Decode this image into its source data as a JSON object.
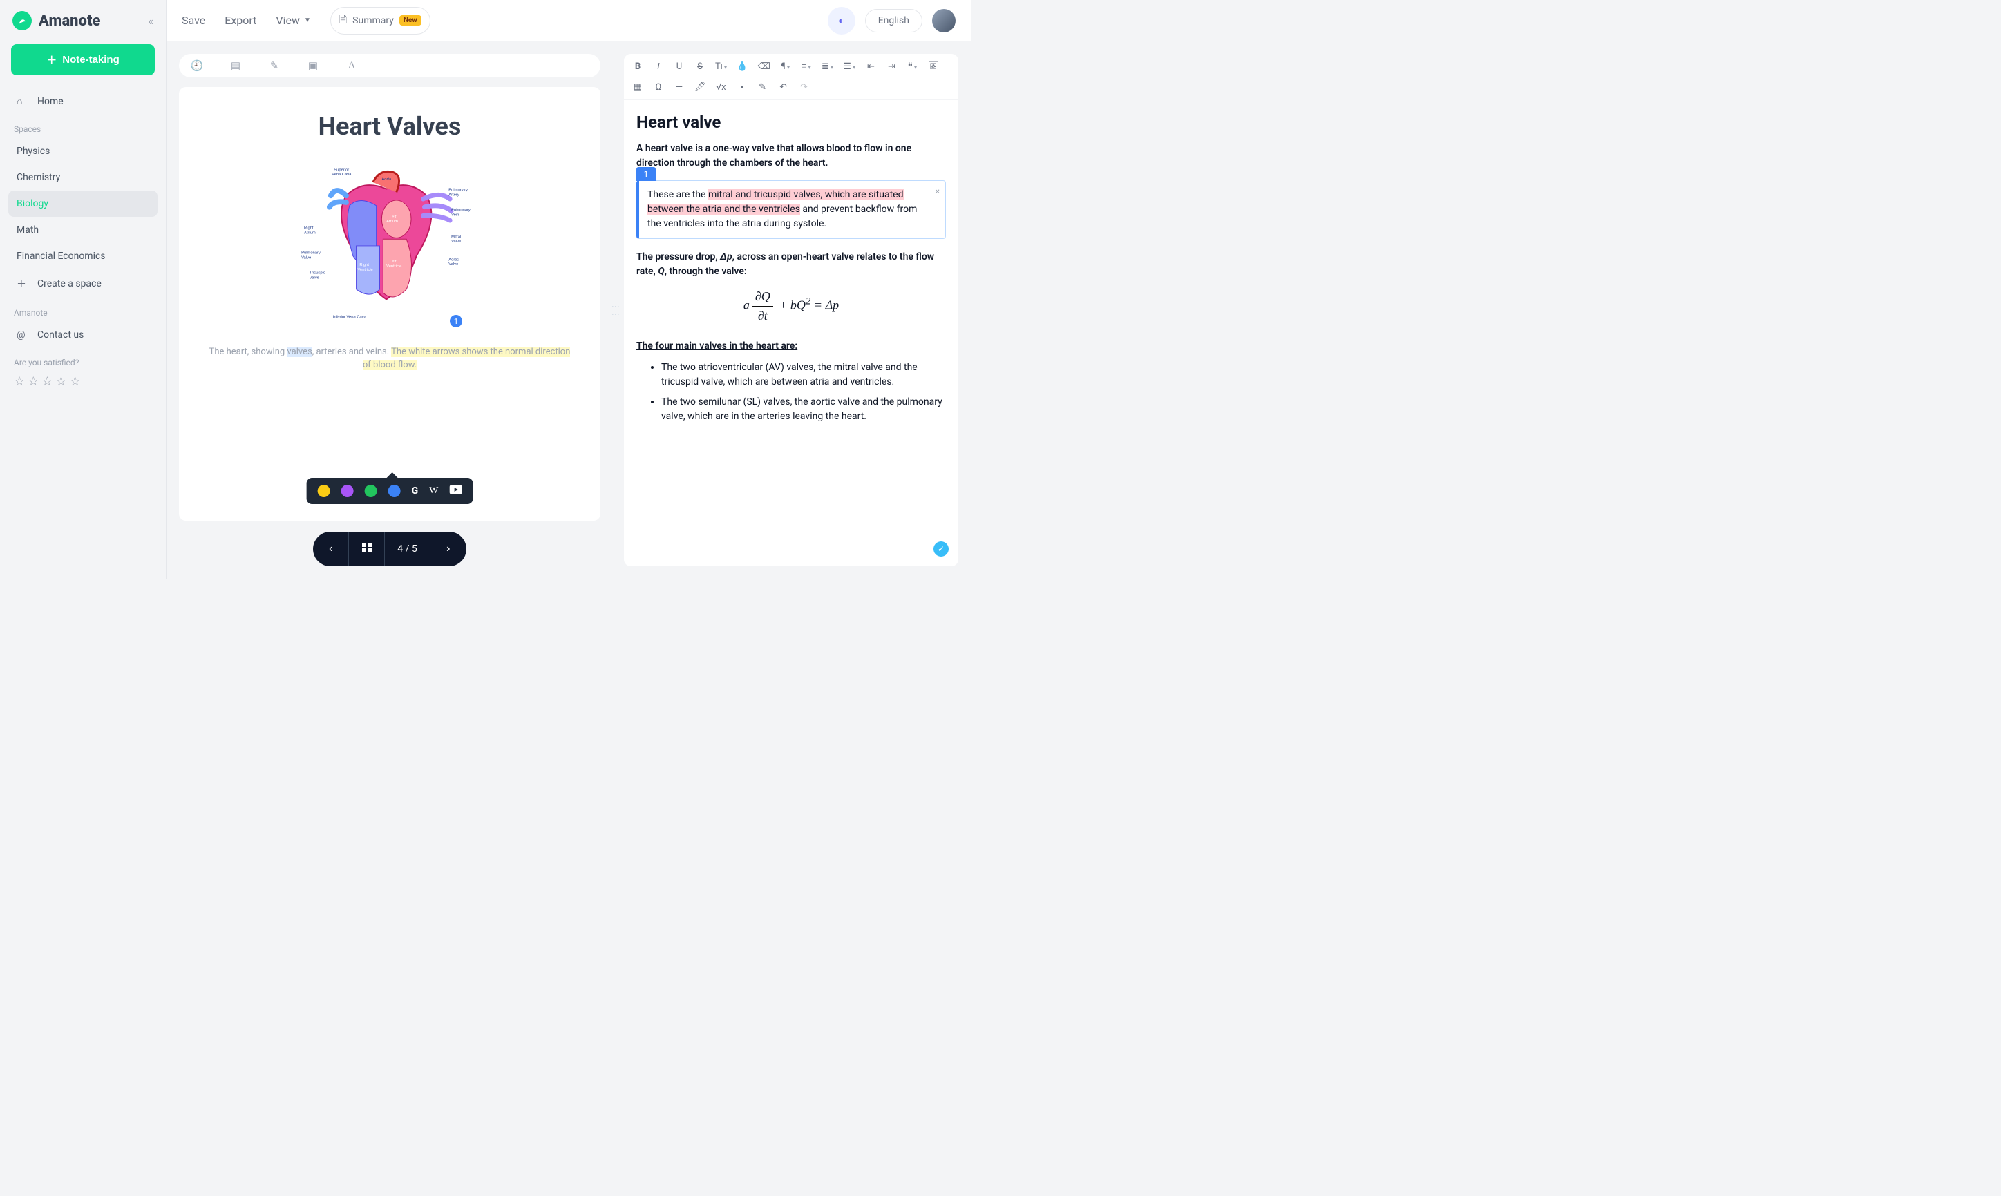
{
  "app": {
    "name": "Amanote"
  },
  "sidebar": {
    "note_taking_label": "Note-taking",
    "home": "Home",
    "spaces_label": "Spaces",
    "spaces": [
      {
        "label": "Physics",
        "active": false
      },
      {
        "label": "Chemistry",
        "active": false
      },
      {
        "label": "Biology",
        "active": true
      },
      {
        "label": "Math",
        "active": false
      },
      {
        "label": "Financial Economics",
        "active": false
      }
    ],
    "create_space": "Create a space",
    "amanote_label": "Amanote",
    "contact": "Contact us",
    "satisfied_label": "Are you satisfied?"
  },
  "topbar": {
    "save": "Save",
    "export": "Export",
    "view": "View",
    "summary": "Summary",
    "new_badge": "New",
    "language": "English"
  },
  "slide": {
    "title": "Heart Valves",
    "reference_num": "1",
    "caption_prefix": "The heart, showing ",
    "caption_hl_blue": "valves",
    "caption_mid": ", arteries and veins. ",
    "caption_hl_yellow": "The white arrows shows the normal direction of blood flow.",
    "heart_labels": {
      "svc": "Superior Vena Cava",
      "aorta": "Aorta",
      "pa": "Pulmonary Artery",
      "pv": "Pulmonary Vein",
      "mv": "Mitral Valve",
      "av": "Aortic Valve",
      "ra": "Right Atrium",
      "la": "Left Atrium",
      "lv": "Left Ventricle",
      "rv": "Right Ventricle",
      "pvalve": "Pulmonary Valve",
      "tv": "Tricuspid Valve",
      "ivc": "Inferior Vena Cava"
    }
  },
  "selection_toolbar": {
    "colors": [
      "#facc15",
      "#a855f7",
      "#22c55e",
      "#3b82f6"
    ],
    "external_icons": [
      "G",
      "W",
      "▶"
    ]
  },
  "pager": {
    "current": 4,
    "total": 5,
    "display": "4 / 5"
  },
  "editor": {
    "title": "Heart valve",
    "intro": "A heart valve is a one-way valve that allows blood to flow in one direction through the chambers of the heart.",
    "note": {
      "num": "1",
      "t1": "These are the ",
      "hl": "mitral and tricuspid valves, which are situated between the atria and the ventricles",
      "t2": " and prevent backflow from the ventricles into the atria during systole."
    },
    "pressure_a": "The pressure drop, ",
    "pressure_b": ", across an open-heart valve relates to the flow rate, ",
    "pressure_c": ", through the valve:",
    "sym_dp": "Δp",
    "sym_q": "Q",
    "formula_parts": {
      "a": "a",
      "num": "∂Q",
      "den": "∂t",
      "plus": " + bQ",
      "sq": "2",
      "eq": " = Δp"
    },
    "list_heading": "The four main valves in the heart are:",
    "items": [
      "The two atrioventricular (AV) valves, the mitral valve and the tricuspid valve, which are between atria and ventricles.",
      "The two semilunar (SL) valves, the aortic valve and the pulmonary valve, which are in the arteries leaving the heart."
    ]
  }
}
